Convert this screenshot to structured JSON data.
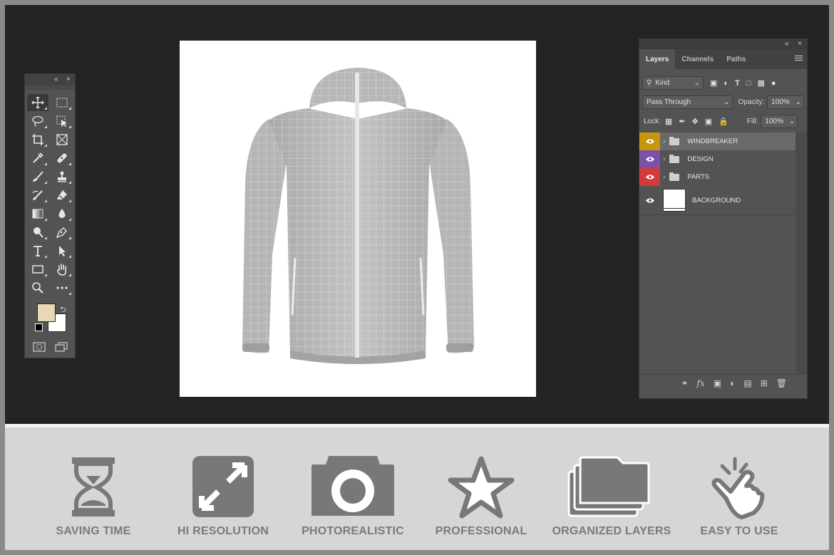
{
  "colors": {
    "workspace": "#232323",
    "panel": "#535353",
    "foreground_swatch": "#e8d9b5",
    "background_swatch": "#ffffff",
    "layer_windbreaker": "#c8960c",
    "layer_design": "#7b52a8",
    "layer_parts": "#d33b3b",
    "feature_icon": "#787878"
  },
  "toolbox": {
    "collapse_glyph": "«",
    "close_glyph": "×",
    "tools": [
      {
        "name": "move-tool-icon"
      },
      {
        "name": "marquee-tool-icon"
      },
      {
        "name": "lasso-tool-icon"
      },
      {
        "name": "object-select-tool-icon"
      },
      {
        "name": "crop-tool-icon"
      },
      {
        "name": "frame-tool-icon"
      },
      {
        "name": "eyedropper-tool-icon"
      },
      {
        "name": "healing-brush-tool-icon"
      },
      {
        "name": "brush-tool-icon"
      },
      {
        "name": "stamp-tool-icon"
      },
      {
        "name": "history-brush-tool-icon"
      },
      {
        "name": "eraser-tool-icon"
      },
      {
        "name": "gradient-tool-icon"
      },
      {
        "name": "blur-tool-icon"
      },
      {
        "name": "dodge-tool-icon"
      },
      {
        "name": "pen-tool-icon"
      },
      {
        "name": "type-tool-icon"
      },
      {
        "name": "path-select-tool-icon"
      },
      {
        "name": "rectangle-tool-icon"
      },
      {
        "name": "hand-tool-icon"
      },
      {
        "name": "zoom-tool-icon"
      },
      {
        "name": "more-tools-icon"
      }
    ]
  },
  "layers_panel": {
    "collapse_glyph": "«",
    "close_glyph": "×",
    "tabs": [
      "Layers",
      "Channels",
      "Paths"
    ],
    "filter_kind": "Kind",
    "blend_mode": "Pass Through",
    "opacity_label": "Opacity:",
    "opacity_value": "100%",
    "lock_label": "Lock:",
    "fill_label": "Fill:",
    "fill_value": "100%",
    "layers": [
      {
        "name": "WINDBREAKER",
        "type": "group"
      },
      {
        "name": "DESIGN",
        "type": "group"
      },
      {
        "name": "PARTS",
        "type": "group"
      },
      {
        "name": "BACKGROUND",
        "type": "layer"
      }
    ],
    "footer_fx": "fx"
  },
  "features": [
    {
      "label": "SAVING TIME",
      "icon": "hourglass-icon"
    },
    {
      "label": "HI RESOLUTION",
      "icon": "expand-icon"
    },
    {
      "label": "PHOTOREALISTIC",
      "icon": "camera-icon"
    },
    {
      "label": "PROFESSIONAL",
      "icon": "star-icon"
    },
    {
      "label": "ORGANIZED LAYERS",
      "icon": "folders-icon"
    },
    {
      "label": "EASY TO USE",
      "icon": "pointing-hand-icon"
    }
  ]
}
